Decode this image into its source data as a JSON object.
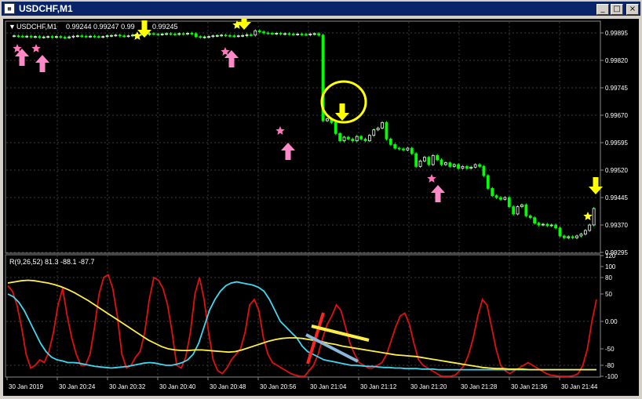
{
  "window": {
    "title": "USDCHF,M1",
    "icon": "chart-window-icon",
    "buttons": [
      {
        "name": "minimize-button",
        "glyph": "_"
      },
      {
        "name": "maximize-button",
        "glyph": "□"
      },
      {
        "name": "close-button",
        "glyph": "×"
      }
    ]
  },
  "main_chart": {
    "header_symbol": "USDCHF,M1",
    "header_prices": "0.99244 0.99247 0.99",
    "header_close": "0.99245",
    "price_labels": [
      "0.99895",
      "0.99820",
      "0.99745",
      "0.99670",
      "0.99595",
      "0.99520",
      "0.99445",
      "0.99370",
      "0.99295"
    ]
  },
  "indicator": {
    "label": "R(9,26,52) 81.3 -88.1 -87.7",
    "scale_labels": [
      "120",
      "100",
      "80",
      "50",
      "0.00",
      "-50",
      "-80",
      "-100"
    ]
  },
  "time_axis": {
    "labels": [
      "30 Jan 2019",
      "30 Jan 20:24",
      "30 Jan 20:32",
      "30 Jan 20:40",
      "30 Jan 20:48",
      "30 Jan 20:56",
      "30 Jan 21:04",
      "30 Jan 21:12",
      "30 Jan 21:20",
      "30 Jan 21:28",
      "30 Jan 21:36",
      "30 Jan 21:44"
    ]
  },
  "colors": {
    "background": "#000000",
    "grid": "#3a3a3a",
    "candle_bull": "#ffffff",
    "candle_bear": "#00ff00",
    "axis_text": "#ffffff",
    "star": "#ffff33",
    "arrow_down": "#ffff00",
    "arrow_up_pink": "#ff88c8",
    "star_pink": "#ff77b8",
    "circle": "#ffff00",
    "line_red": "#e01010",
    "line_cyan": "#40d8f0",
    "line_yellow": "#ffee44",
    "line_gray": "#b8b8b8"
  },
  "chart_data": [
    {
      "type": "candlestick",
      "symbol": "USDCHF,M1",
      "ylim": [
        0.99295,
        0.99925
      ],
      "close": [
        0.99887,
        0.99886,
        0.99885,
        0.99886,
        0.99884,
        0.99885,
        0.99883,
        0.99884,
        0.99885,
        0.99884,
        0.99885,
        0.99883,
        0.99882,
        0.99884,
        0.99886,
        0.99887,
        0.99886,
        0.99885,
        0.99886,
        0.99885,
        0.99884,
        0.99885,
        0.99887,
        0.99888,
        0.99889,
        0.99887,
        0.99886,
        0.99887,
        0.99889,
        0.99892,
        0.9989,
        0.99891,
        0.99893,
        0.99892,
        0.99891,
        0.99892,
        0.99893,
        0.99892,
        0.99891,
        0.99893,
        0.99892,
        0.99894,
        0.99893,
        0.99885,
        0.99883,
        0.99884,
        0.99885,
        0.99887,
        0.99888,
        0.99889,
        0.99888,
        0.99887,
        0.99886,
        0.99887,
        0.99888,
        0.9989,
        0.99889,
        0.99901,
        0.99898,
        0.99895,
        0.99894,
        0.99893,
        0.99894,
        0.99892,
        0.99893,
        0.99892,
        0.99891,
        0.99892,
        0.99891,
        0.9989,
        0.99892,
        0.99893,
        0.99889,
        0.99655,
        0.9966,
        0.9965,
        0.9962,
        0.996,
        0.9961,
        0.99605,
        0.996,
        0.99612,
        0.99605,
        0.996,
        0.99615,
        0.9963,
        0.99635,
        0.9965,
        0.99605,
        0.9959,
        0.9958,
        0.99578,
        0.99575,
        0.9958,
        0.99565,
        0.9953,
        0.99545,
        0.99555,
        0.99535,
        0.9956,
        0.99548,
        0.99535,
        0.9954,
        0.9953,
        0.99535,
        0.99525,
        0.9953,
        0.99525,
        0.99528,
        0.99535,
        0.9953,
        0.99505,
        0.9947,
        0.9945,
        0.99445,
        0.9944,
        0.99445,
        0.9942,
        0.994,
        0.9942,
        0.99425,
        0.99395,
        0.9939,
        0.99375,
        0.9937,
        0.99372,
        0.99368,
        0.9937,
        0.99362,
        0.9934,
        0.99335,
        0.99338,
        0.99335,
        0.9934,
        0.99345,
        0.99355,
        0.9937,
        0.99415
      ]
    },
    {
      "type": "line",
      "name": "R(9,26,52)",
      "ylim": [
        -100,
        120
      ],
      "series": [
        {
          "name": "9",
          "values": [
            65,
            55,
            30,
            -10,
            -60,
            -85,
            -80,
            -70,
            -75,
            -55,
            -20,
            30,
            60,
            10,
            -30,
            -60,
            -80,
            -80,
            -60,
            -10,
            50,
            80,
            85,
            60,
            10,
            -60,
            -85,
            -80,
            -65,
            -55,
            -20,
            40,
            80,
            75,
            60,
            30,
            -20,
            -80,
            -85,
            -65,
            -20,
            50,
            80,
            40,
            -20,
            -70,
            -90,
            -95,
            -85,
            -70,
            -60,
            -50,
            -20,
            30,
            40,
            20,
            -30,
            -60,
            -75,
            -80,
            -85,
            -90,
            -95,
            -98,
            -100,
            -100,
            -90,
            -80,
            -60,
            -30,
            -5,
            10,
            30,
            20,
            -10,
            -40,
            -60,
            -75,
            -80,
            -85,
            -85,
            -80,
            -75,
            -60,
            -35,
            -10,
            10,
            15,
            -5,
            -40,
            -70,
            -80,
            -85,
            -90,
            -95,
            -100,
            -100,
            -100,
            -98,
            -90,
            -80,
            -60,
            -30,
            10,
            40,
            30,
            -10,
            -50,
            -80,
            -90,
            -95,
            -90,
            -85,
            -80,
            -75,
            -80,
            -85,
            -90,
            -95,
            -98,
            -99,
            -100,
            -100,
            -100,
            -99,
            -95,
            -80,
            -50,
            0,
            40
          ]
        },
        {
          "name": "26",
          "values": [
            50,
            45,
            35,
            20,
            0,
            -20,
            -40,
            -55,
            -65,
            -70,
            -72,
            -75,
            -75,
            -76,
            -78,
            -80,
            -82,
            -83,
            -84,
            -85,
            -84,
            -83,
            -82,
            -80,
            -78,
            -76,
            -75,
            -76,
            -78,
            -80,
            -80,
            -78,
            -75,
            -70,
            -60,
            -40,
            -10,
            20,
            40,
            55,
            65,
            70,
            72,
            70,
            68,
            66,
            62,
            55,
            40,
            20,
            0,
            -10,
            -20,
            -30,
            -45,
            -55,
            -60,
            -65,
            -70,
            -72,
            -74,
            -76,
            -78,
            -80,
            -80,
            -81,
            -82,
            -82,
            -83,
            -84,
            -84,
            -85,
            -85,
            -86,
            -86,
            -86,
            -87,
            -87,
            -87,
            -88,
            -88,
            -88,
            -88,
            -88,
            -88,
            -88,
            -88,
            -88,
            -88,
            -88,
            -88,
            -88,
            -88,
            -88,
            -88,
            -88,
            -88,
            -88,
            -88,
            -88,
            -88,
            -88,
            -88,
            -88,
            -88,
            -88,
            -88,
            -88,
            -88
          ]
        },
        {
          "name": "52",
          "values": [
            70,
            72,
            74,
            75,
            74,
            72,
            70,
            67,
            63,
            58,
            52,
            45,
            38,
            30,
            22,
            14,
            6,
            -2,
            -10,
            -18,
            -26,
            -34,
            -40,
            -46,
            -50,
            -52,
            -53,
            -53,
            -52,
            -52,
            -53,
            -54,
            -55,
            -56,
            -55,
            -52,
            -48,
            -44,
            -40,
            -36,
            -33,
            -31,
            -30,
            -30,
            -31,
            -33,
            -35,
            -37,
            -40,
            -42,
            -45,
            -47,
            -49,
            -51,
            -53,
            -55,
            -57,
            -59,
            -61,
            -62,
            -63,
            -64,
            -66,
            -68,
            -70,
            -72,
            -74,
            -76,
            -78,
            -80,
            -82,
            -84,
            -85,
            -86,
            -86,
            -87,
            -87,
            -87,
            -88,
            -88,
            -88,
            -88,
            -88,
            -88,
            -88,
            -88,
            -88,
            -88,
            -88
          ]
        }
      ]
    }
  ]
}
